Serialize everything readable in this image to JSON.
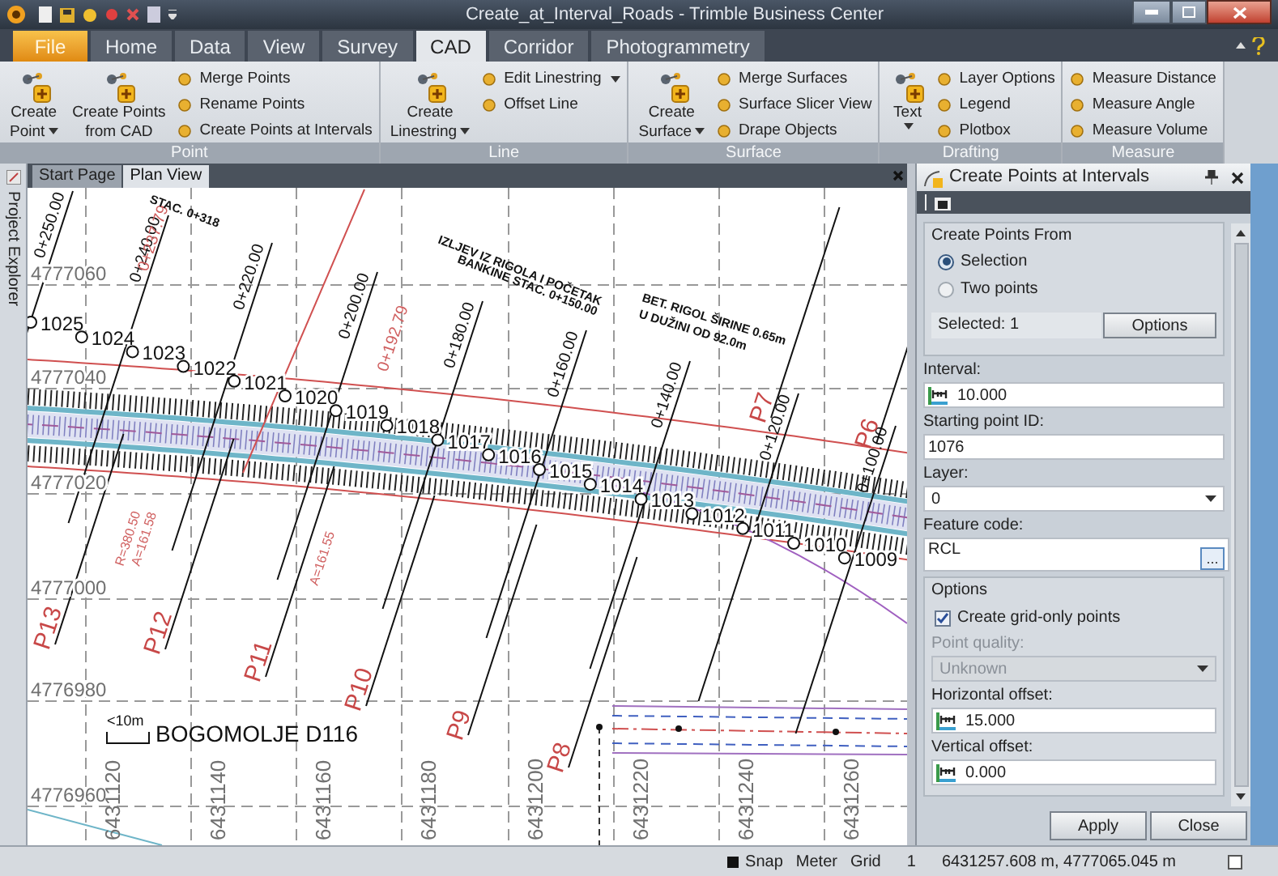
{
  "window": {
    "title": "Create_at_Interval_Roads - Trimble Business Center"
  },
  "ribbon": {
    "tabs": [
      {
        "label": "File",
        "kind": "file",
        "selected": false
      },
      {
        "label": "Home",
        "kind": "tab",
        "selected": false
      },
      {
        "label": "Data",
        "kind": "tab",
        "selected": false
      },
      {
        "label": "View",
        "kind": "tab",
        "selected": false
      },
      {
        "label": "Survey",
        "kind": "tab",
        "selected": false
      },
      {
        "label": "CAD",
        "kind": "tab",
        "selected": true
      },
      {
        "label": "Corridor",
        "kind": "tab",
        "selected": false
      },
      {
        "label": "Photogrammetry",
        "kind": "tab",
        "selected": false
      }
    ],
    "groups": [
      {
        "label": "Point",
        "items": [
          {
            "kind": "large",
            "lines": [
              "Create",
              "Point"
            ],
            "dropdown": true
          },
          {
            "kind": "large",
            "lines": [
              "Create Points",
              "from CAD"
            ],
            "dropdown": false
          },
          {
            "kind": "small",
            "label": "Merge Points",
            "dropdown": false
          },
          {
            "kind": "small",
            "label": "Rename Points",
            "dropdown": false
          },
          {
            "kind": "small",
            "label": "Create Points at Intervals",
            "dropdown": false
          }
        ]
      },
      {
        "label": "Line",
        "items": [
          {
            "kind": "large",
            "lines": [
              "Create",
              "Linestring"
            ],
            "dropdown": true
          },
          {
            "kind": "small",
            "label": "Edit Linestring",
            "dropdown": true
          },
          {
            "kind": "small",
            "label": "Offset Line",
            "dropdown": false
          }
        ]
      },
      {
        "label": "Surface",
        "items": [
          {
            "kind": "large",
            "lines": [
              "Create",
              "Surface"
            ],
            "dropdown": true
          },
          {
            "kind": "small",
            "label": "Merge Surfaces",
            "dropdown": false
          },
          {
            "kind": "small",
            "label": "Surface Slicer View",
            "dropdown": false
          },
          {
            "kind": "small",
            "label": "Drape Objects",
            "dropdown": false
          }
        ]
      },
      {
        "label": "Drafting",
        "items": [
          {
            "kind": "large",
            "lines": [
              "Text"
            ],
            "dropdown": true
          },
          {
            "kind": "small",
            "label": "Layer Options",
            "dropdown": false
          },
          {
            "kind": "small",
            "label": "Legend",
            "dropdown": false
          },
          {
            "kind": "small",
            "label": "Plotbox",
            "dropdown": false
          }
        ]
      },
      {
        "label": "Measure",
        "items": [
          {
            "kind": "small",
            "label": "Measure Distance",
            "dropdown": false
          },
          {
            "kind": "small",
            "label": "Measure Angle",
            "dropdown": false
          },
          {
            "kind": "small",
            "label": "Measure Volume",
            "dropdown": false
          }
        ]
      }
    ]
  },
  "side_tab": "Project Explorer",
  "doc_tabs": [
    {
      "label": "Start Page",
      "selected": false
    },
    {
      "label": "Plan View",
      "selected": true
    }
  ],
  "plan": {
    "northings": [
      "4777060",
      "4777040",
      "4777020",
      "4777000",
      "4776980",
      "4776960"
    ],
    "eastings": [
      "6431120",
      "6431140",
      "6431160",
      "6431180",
      "6431200",
      "6431220",
      "6431240",
      "6431260"
    ],
    "points": [
      "1025",
      "1024",
      "1023",
      "1022",
      "1021",
      "1020",
      "1019",
      "1018",
      "1017",
      "1016",
      "1015",
      "1014",
      "1013",
      "1012",
      "1011",
      "1010",
      "1009"
    ],
    "stations": [
      "0+250.00",
      "0+240.00",
      "0+220.00",
      "0+200.00",
      "0+180.00",
      "0+160.00",
      "0+140.00",
      "0+120.00",
      "0+100.00"
    ],
    "station_notes": [
      "0+237.79",
      "0+192.79"
    ],
    "profiles": [
      "P13",
      "P12",
      "P11",
      "P10",
      "P9",
      "P8",
      "P7",
      "P6"
    ],
    "curve_notes": [
      "R=380.50",
      "A=161.58",
      "A=161.55"
    ],
    "annotations": [
      "STAC. 0+318",
      "IZLJEV IZ RIGOLA I POČETAK",
      "BANKINE STAC. 0+150.00",
      "BET. RIGOL ŠIRINE 0.65m",
      "U DUŽINI OD 92.0m"
    ],
    "road_label": "BOGOMOLJE D116",
    "scale_label": "<10m"
  },
  "panel": {
    "title": "Create Points at Intervals",
    "source": {
      "label": "Create Points From",
      "options": [
        {
          "label": "Selection",
          "selected": true
        },
        {
          "label": "Two points",
          "selected": false
        }
      ],
      "selected_text": "Selected: 1",
      "button": "Options"
    },
    "fields": [
      {
        "kind": "measure",
        "label": "Interval:",
        "value": "10.000",
        "disabled": false
      },
      {
        "kind": "text",
        "label": "Starting point ID:",
        "value": "1076",
        "disabled": false
      },
      {
        "kind": "select",
        "label": "Layer:",
        "value": "0",
        "disabled": false
      },
      {
        "kind": "browse",
        "label": "Feature code:",
        "value": "RCL",
        "button": "...",
        "disabled": false
      }
    ],
    "options": {
      "label": "Options",
      "grid_only": {
        "label": "Create grid-only points",
        "checked": true
      },
      "fields": [
        {
          "kind": "select",
          "label": "Point quality:",
          "value": "Unknown",
          "disabled": true
        },
        {
          "kind": "measure",
          "label": "Horizontal offset:",
          "value": "15.000",
          "disabled": false
        },
        {
          "kind": "measure",
          "label": "Vertical offset:",
          "value": "0.000",
          "disabled": false
        }
      ]
    },
    "buttons": [
      "Apply",
      "Close"
    ]
  },
  "status_bar": {
    "snap": "Snap",
    "units": "Meter",
    "grid": "Grid",
    "grid_value": "1",
    "coordinates": "6431257.608 m, 4777065.045 m"
  }
}
